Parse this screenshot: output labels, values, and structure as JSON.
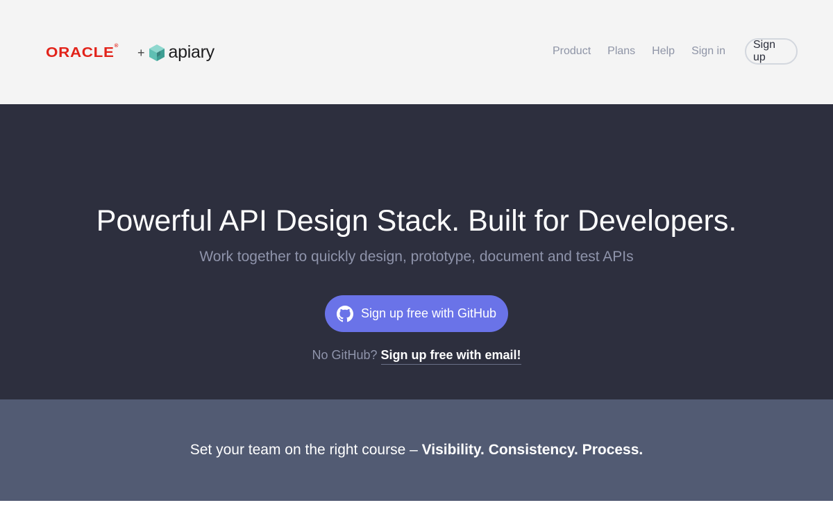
{
  "header": {
    "brand": {
      "oracle_label": "ORACLE",
      "oracle_reg": "®",
      "plus": "+",
      "apiary_label": "apiary"
    },
    "nav": {
      "items": [
        "Product",
        "Plans",
        "Help",
        "Sign in"
      ],
      "signup_label": "Sign up"
    }
  },
  "hero": {
    "title": "Powerful API Design Stack. Built for Developers.",
    "subtitle": "Work together to quickly design, prototype, document and test APIs",
    "github_button_label": "Sign up free with GitHub",
    "github_icon": "github-icon",
    "alt_prefix": "No GitHub?",
    "alt_link": "Sign up free with email!"
  },
  "band": {
    "text_prefix": "Set your team on the right course –",
    "text_strong": "Visibility. Consistency. Process."
  },
  "colors": {
    "oracle_red": "#e2231a",
    "hero_bg": "#2d2f3e",
    "band_bg": "#525b73",
    "cta": "#6a73e8",
    "header_bg": "#f4f4f4",
    "apiary_teal": "#5fbfb3"
  }
}
